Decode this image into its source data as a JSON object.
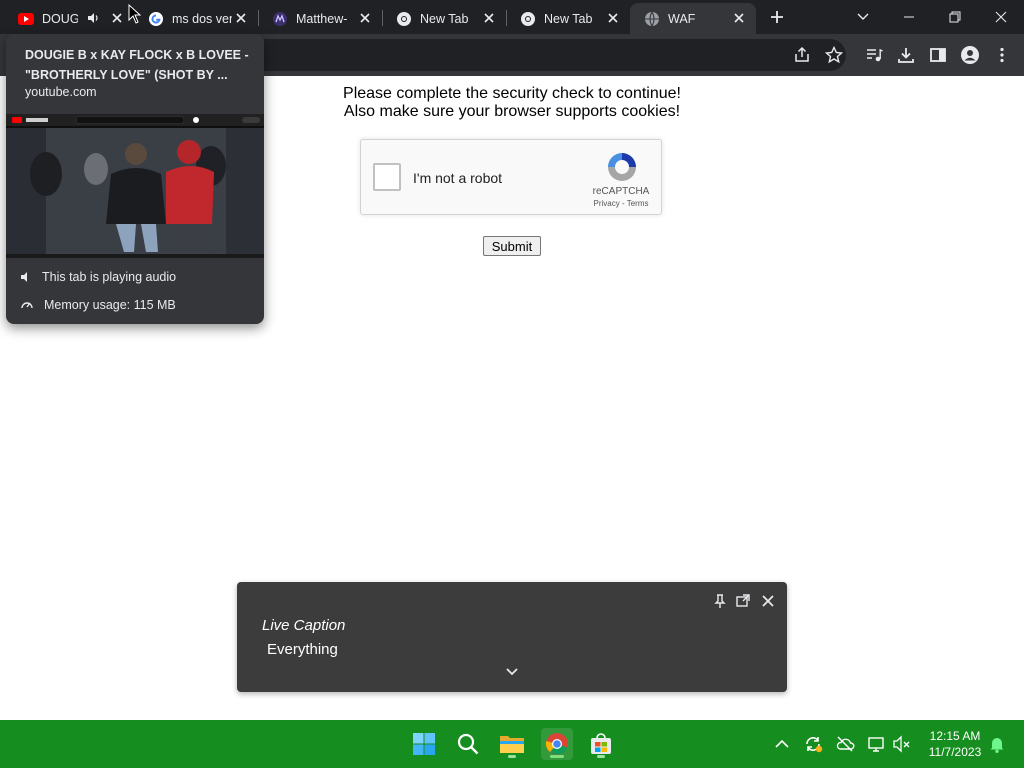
{
  "tabs": [
    {
      "title": "DOUG",
      "favicon": "youtube-icon",
      "audio": true
    },
    {
      "title": "ms dos ver",
      "favicon": "google-icon"
    },
    {
      "title": "Matthew-",
      "favicon": "matthew-icon"
    },
    {
      "title": "New Tab",
      "favicon": "chrome-icon"
    },
    {
      "title": "New Tab",
      "favicon": "chrome-icon"
    },
    {
      "title": "WAF",
      "favicon": "globe-icon",
      "active": true
    }
  ],
  "page": {
    "message_line1": "Please complete the security check to continue!",
    "message_line2": "Also make sure your browser supports cookies!",
    "recaptcha": {
      "label": "I'm not a robot",
      "brand": "reCAPTCHA",
      "privacy": "Privacy",
      "separator": " - ",
      "terms": "Terms"
    },
    "submit_label": "Submit"
  },
  "hover_card": {
    "title": "DOUGIE B x KAY FLOCK x B LOVEE - \"BROTHERLY LOVE\" (SHOT BY ...",
    "domain": "youtube.com",
    "audio_status": "This tab is playing audio",
    "memory_usage": "Memory usage: 115 MB"
  },
  "live_caption": {
    "title": "Live Caption",
    "text": "Everything"
  },
  "taskbar": {
    "time": "12:15 AM",
    "date": "11/7/2023",
    "accent": "#168d1f"
  }
}
